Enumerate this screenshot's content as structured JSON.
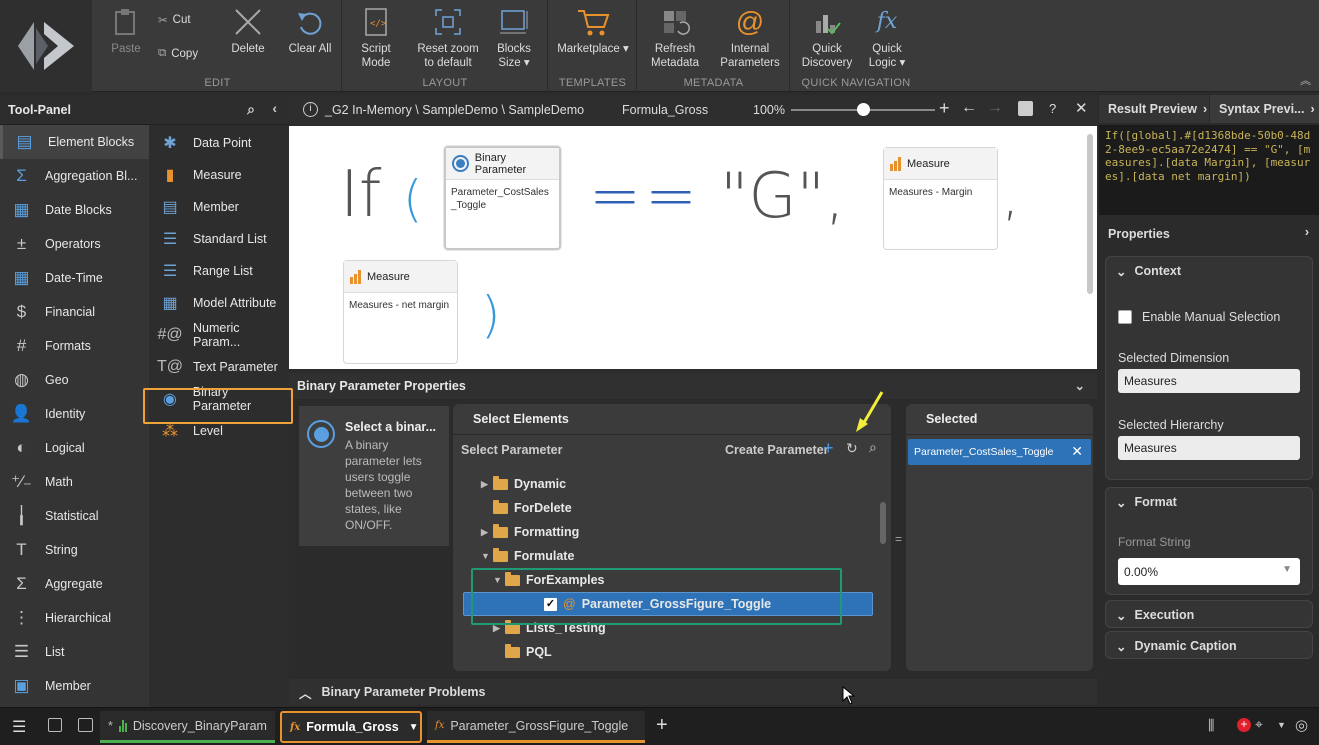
{
  "ribbon": {
    "groups": {
      "edit": "EDIT",
      "layout": "LAYOUT",
      "templates": "TEMPLATES",
      "metadata": "METADATA",
      "quick_navigation": "QUICK NAVIGATION"
    },
    "paste": "Paste",
    "cut": "Cut",
    "copy": "Copy",
    "delete": "Delete",
    "clear_all": "Clear All",
    "script_mode_1": "Script",
    "script_mode_2": "Mode",
    "reset_zoom_1": "Reset zoom",
    "reset_zoom_2": "to default",
    "blocks_size_1": "Blocks",
    "blocks_size_2": "Size ▾",
    "marketplace": "Marketplace ▾",
    "refresh_metadata_1": "Refresh",
    "refresh_metadata_2": "Metadata",
    "internal_params_1": "Internal",
    "internal_params_2": "Parameters",
    "quick_discovery_1": "Quick",
    "quick_discovery_2": "Discovery",
    "quick_logic_1": "Quick",
    "quick_logic_2": "Logic ▾",
    "accent": "#e8922e"
  },
  "toolpanel": {
    "title": "Tool-Panel",
    "categories": [
      {
        "label": "Element Blocks",
        "icon": "element-blocks-icon"
      },
      {
        "label": "Aggregation Bl...",
        "icon": "aggregation-blocks-icon"
      },
      {
        "label": "Date Blocks",
        "icon": "date-blocks-icon"
      },
      {
        "label": "Operators",
        "icon": "operators-icon"
      },
      {
        "label": "Date-Time",
        "icon": "calendar-icon"
      },
      {
        "label": "Financial",
        "icon": "dollar-icon"
      },
      {
        "label": "Formats",
        "icon": "formats-icon"
      },
      {
        "label": "Geo",
        "icon": "globe-icon"
      },
      {
        "label": "Identity",
        "icon": "person-icon"
      },
      {
        "label": "Logical",
        "icon": "logical-icon"
      },
      {
        "label": "Math",
        "icon": "math-icon"
      },
      {
        "label": "Statistical",
        "icon": "statistical-icon"
      },
      {
        "label": "String",
        "icon": "string-icon"
      },
      {
        "label": "Aggregate",
        "icon": "sigma-icon"
      },
      {
        "label": "Hierarchical",
        "icon": "hierarchy-icon"
      },
      {
        "label": "List",
        "icon": "list-icon"
      },
      {
        "label": "Member",
        "icon": "member-icon"
      }
    ],
    "blocks": [
      {
        "label": "Data Point",
        "icon": "data-point-icon"
      },
      {
        "label": "Measure",
        "icon": "measure-icon"
      },
      {
        "label": "Member",
        "icon": "member-icon"
      },
      {
        "label": "Standard List",
        "icon": "standard-list-icon"
      },
      {
        "label": "Range List",
        "icon": "range-list-icon"
      },
      {
        "label": "Model Attribute",
        "icon": "model-attribute-icon"
      },
      {
        "label": "Numeric Param...",
        "icon": "numeric-parameter-icon"
      },
      {
        "label": "Text Parameter",
        "icon": "text-parameter-icon"
      },
      {
        "label": "Binary Parameter",
        "icon": "binary-parameter-icon"
      },
      {
        "label": "Level",
        "icon": "level-icon"
      }
    ]
  },
  "editor": {
    "breadcrumb": "_G2 In-Memory \\ SampleDemo \\ SampleDemo",
    "formula_name": "Formula_Gross",
    "zoom": "100%",
    "zoom_fraction": 0.5,
    "tokens": {
      "if": "If",
      "open_paren": "(",
      "equals": "==",
      "string": "\"G\",",
      "comma": ",",
      "close_paren": ")"
    },
    "cards": {
      "binary": {
        "title": "Binary Parameter",
        "body": "Parameter_CostSales_Toggle"
      },
      "measure1": {
        "title": "Measure",
        "body": "Measures - Margin"
      },
      "measure2": {
        "title": "Measure",
        "body": "Measures - net margin"
      }
    }
  },
  "properties_panel": {
    "title": "Binary Parameter Properties",
    "info_title": "Select a binar...",
    "info_body": "A binary parameter lets users toggle between two states, like ON/OFF.",
    "select_elements": "Select Elements",
    "select_parameter": "Select Parameter",
    "create_parameter": "Create Parameter",
    "selected_title": "Selected",
    "selected_item": "Parameter_CostSales_Toggle",
    "tree": [
      {
        "label": "Dynamic",
        "expanded": false
      },
      {
        "label": "ForDelete",
        "expanded": null
      },
      {
        "label": "Formatting",
        "expanded": false
      },
      {
        "label": "Formulate",
        "expanded": true
      },
      {
        "label": "ForExamples",
        "expanded": true
      },
      {
        "label": "Parameter_GrossFigure_Toggle",
        "checked": true
      },
      {
        "label": "Lists_Testing",
        "expanded": false
      },
      {
        "label": "PQL",
        "expanded": null
      }
    ],
    "problems": "Binary Parameter Problems"
  },
  "right_panel": {
    "tab_result": "Result Preview",
    "tab_syntax": "Syntax Previ...",
    "syntax_text": "If([global].#[d1368bde-50b0-48d2-8ee9-ec5aa72e2474] == \"G\", [measures].[data Margin], [measures].[data net margin])",
    "properties": "Properties",
    "context": "Context",
    "manual_selection": "Enable Manual Selection",
    "selected_dimension_label": "Selected Dimension",
    "selected_dimension": "Measures",
    "selected_hierarchy_label": "Selected Hierarchy",
    "selected_hierarchy": "Measures",
    "format": "Format",
    "format_string_label": "Format String",
    "format_string": "0.00%",
    "execution": "Execution",
    "dynamic_caption": "Dynamic Caption"
  },
  "taskbar": {
    "tabs": [
      {
        "label": "Discovery_BinaryParam",
        "prefix": "*"
      },
      {
        "label": "Formula_Gross"
      },
      {
        "label": "Parameter_GrossFigure_Toggle"
      }
    ],
    "add": "+"
  }
}
